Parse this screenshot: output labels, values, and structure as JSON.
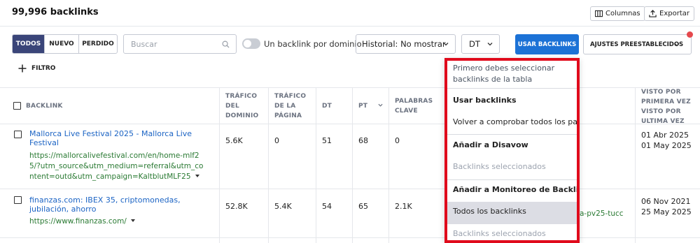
{
  "header": {
    "title": "99,996 backlinks",
    "columns_label": "Columnas",
    "export_label": "Exportar"
  },
  "toolbar": {
    "segments": [
      "TODOS",
      "NUEVO",
      "PERDIDO"
    ],
    "active_segment": "TODOS",
    "search_placeholder": "Buscar",
    "toggle_label": "Un backlink por dominio",
    "history_select": "Historial: No mostrar",
    "dt_select": "DT",
    "use_backlinks_label": "USAR BACKLINKS",
    "presets_label": "AJUSTES PREESTABLECIDOS",
    "filter_label": "FILTRO",
    "accent_color": "#1c72d6",
    "active_segment_color": "#3a4579",
    "notification_dot_color": "#e5484d"
  },
  "table": {
    "headers": {
      "backlink": "BACKLINK",
      "domain_traffic_1": "TRÁFICO",
      "domain_traffic_2": "DEL",
      "domain_traffic_3": "DOMINIO",
      "page_traffic_1": "TRÁFICO",
      "page_traffic_2": "DE LA",
      "page_traffic_3": "PÁGINA",
      "dt": "DT",
      "pt": "PT",
      "keywords_1": "PALABRAS",
      "keywords_2": "CLAVE",
      "seen_1": "VISTO POR",
      "seen_2": "PRIMERA VEZ",
      "seen_3": "VISTO POR",
      "seen_4": "ULTIMA VEZ"
    },
    "rows": [
      {
        "title_1": "Mallorca Live Festival 2025 - Mallorca Live",
        "title_2": "Festival",
        "url_1": "https://mallorcalivefestival.com/en/home-mlf2",
        "url_2": "5/?utm_source&utm_medium=referral&utm_co",
        "url_3": "ntent=outd&utm_campaign=KaltblutMLF25",
        "domain_traffic": "5.6K",
        "page_traffic": "0",
        "dt": "51",
        "pt": "68",
        "keywords": "0",
        "first_seen": "01 Abr 2025",
        "last_seen": "01 May 2025"
      },
      {
        "title_1": "finanzas.com: IBEX 35, criptomonedas,",
        "title_2": "jubilación, ahorro",
        "url_1": "https://www.finanzas.com/",
        "domain_traffic": "52.8K",
        "page_traffic": "5.4K",
        "dt": "54",
        "pt": "65",
        "keywords": "2.1K",
        "target_partial": "a-pv25-tucc",
        "first_seen": "06 Nov 2021",
        "last_seen": "25 May 2025"
      }
    ]
  },
  "dropdown": {
    "note_1": "Primero debes seleccionar",
    "note_2": "backlinks de la tabla",
    "section_1": "Usar backlinks",
    "item_1": "Volver a comprobar todos los par...",
    "section_2": "Añadir a Disavow",
    "item_2": "Backlinks seleccionados",
    "section_3": "Añadir a Monitoreo de Backlinks",
    "item_3": "Todos los backlinks",
    "item_4": "Backlinks seleccionados",
    "highlight_border_color": "#e00b1c"
  }
}
